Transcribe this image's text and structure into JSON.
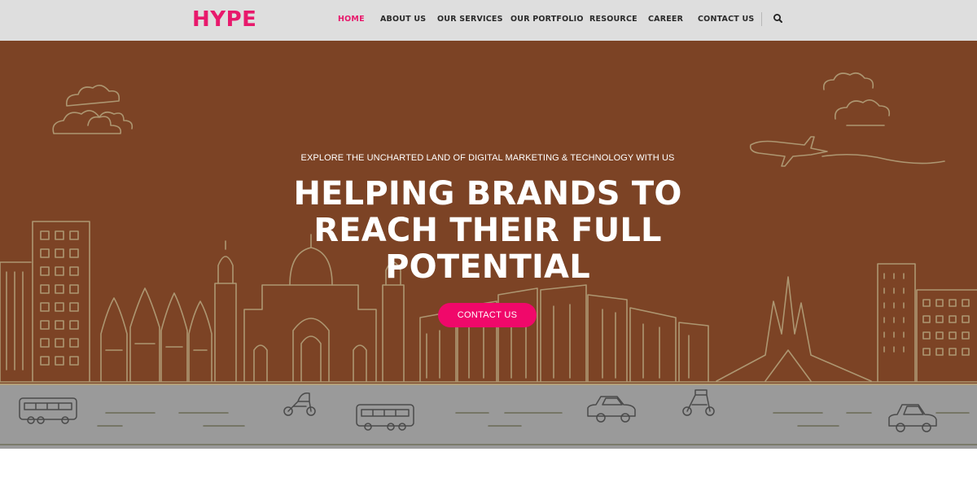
{
  "brand": {
    "logo_text": "HYPE",
    "accent_color": "#e8196c"
  },
  "nav": {
    "items": [
      {
        "label": "HOME",
        "active": true
      },
      {
        "label": "ABOUT US",
        "active": false
      },
      {
        "label": "OUR SERVICES",
        "active": false
      },
      {
        "label": "OUR PORTFOLIO",
        "active": false
      },
      {
        "label": "RESOURCE",
        "active": false
      },
      {
        "label": "CAREER",
        "active": false
      },
      {
        "label": "CONTACT US",
        "active": false
      }
    ],
    "search_icon": "search-icon",
    "active_color": "#e8196c"
  },
  "hero": {
    "tagline": "EXPLORE THE UNCHARTED LAND OF DIGITAL MARKETING & TECHNOLOGY WITH US",
    "headline": "HELPING BRANDS TO REACH THEIR FULL POTENTIAL",
    "cta_label": "CONTACT US",
    "background_color": "#7c4325",
    "sketch_color": "#b3a07a",
    "cta_color": "#f0086a"
  },
  "road": {
    "color": "#9a9a9a",
    "vehicles": [
      "bus-icon",
      "rickshaw-icon",
      "bus-icon",
      "car-icon",
      "rickshaw-icon",
      "car-icon"
    ]
  }
}
